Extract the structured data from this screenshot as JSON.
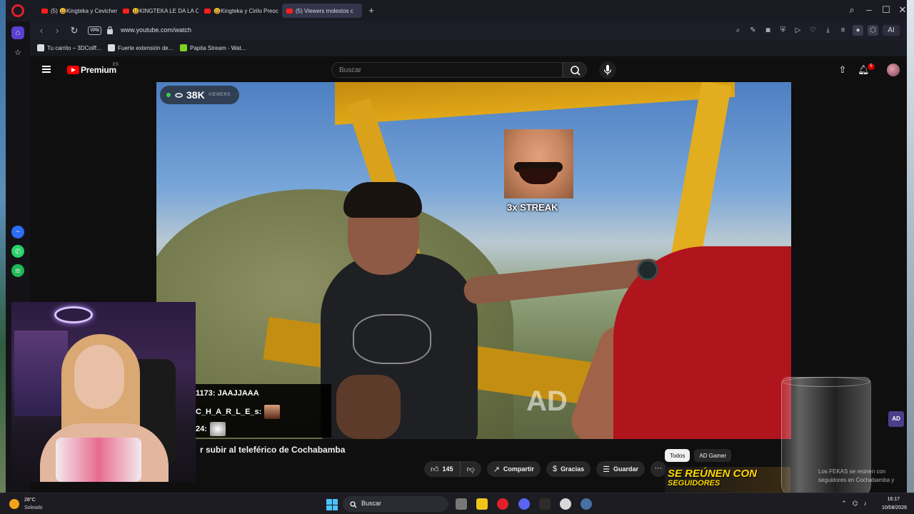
{
  "browser": {
    "tabs": [
      {
        "label": "(5) 😃Kingteka y Cevicher"
      },
      {
        "label": "😃KINGTEKA LE DA LA CO"
      },
      {
        "label": "😃Kingteka y Cirilo Preoc"
      },
      {
        "label": "(5) Viewers molestos c"
      }
    ],
    "new_tab": "+",
    "vpn": "VPN",
    "url": "www.youtube.com/watch",
    "ai_label": "AI",
    "bookmarks": [
      {
        "label": "Tu carrito – 3DCoiff..."
      },
      {
        "label": "Fuerte extensión de..."
      },
      {
        "label": "Papita Stream - Wat..."
      }
    ]
  },
  "youtube": {
    "brand": "Premium",
    "region": "ES",
    "search_placeholder": "Buscar",
    "notifications_count": "5",
    "video_title": "r subir al teleférico de Cochabamba",
    "likes": "145",
    "share_label": "Compartir",
    "thanks_label": "Gracias",
    "save_label": "Guardar",
    "more_label": "···",
    "chips": [
      "Todos",
      "AD Gamer"
    ],
    "rec_thumb_text": "SE REÚNEN CON",
    "rec_thumb_text2": "SEGUIDORES",
    "rec_desc": "Los FEKAS se reúnen con seguidores en Cochabamba y"
  },
  "stream_overlay": {
    "viewer_count": "38K",
    "viewer_label": "VIEWERS",
    "streak": "3x STREAK",
    "watermark": "AD",
    "ad_badge": "AD",
    "chat": [
      {
        "text": "1173: JAAJJAAA"
      },
      {
        "text": "C_H_A_R_L_E_s:"
      },
      {
        "text": "24:"
      }
    ]
  },
  "taskbar": {
    "temperature": "28°C",
    "weather": "Soleado",
    "search": "Buscar",
    "time": "16:17",
    "date": "10/08/2026"
  },
  "colors": {
    "accent_red": "#ff0000",
    "live_green": "#34d058",
    "windows_blue": "#4cc2ff"
  }
}
